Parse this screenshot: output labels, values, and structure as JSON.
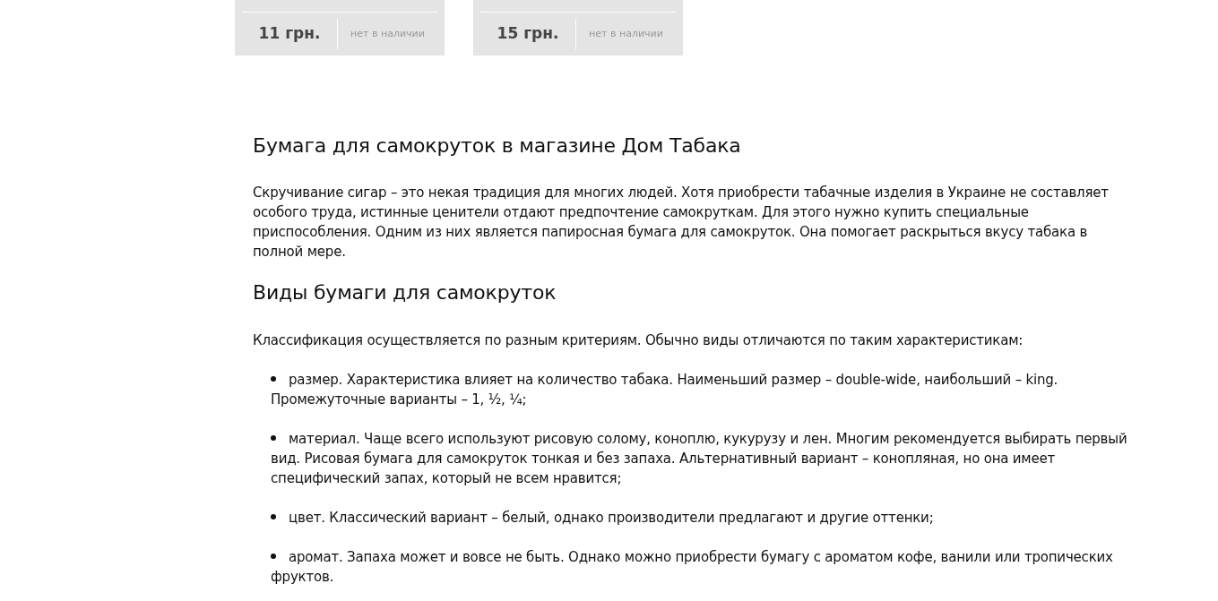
{
  "products": [
    {
      "price": "11 грн.",
      "availability": "нет в наличии"
    },
    {
      "price": "15 грн.",
      "availability": "нет в наличии"
    }
  ],
  "article": [
    {
      "kind": "heading",
      "text": "Бумага для самокруток в магазине Дом Табака"
    },
    {
      "kind": "paragraph",
      "text": "Скручивание сигар – это некая традиция для многих людей. Хотя приобрести табачные изделия в Украине не составляет особого труда, истинные ценители отдают предпочтение самокруткам. Для этого нужно купить специальные приспособления. Одним из них является папиросная бумага для самокруток. Она помогает раскрыться вкусу табака в полной мере."
    },
    {
      "kind": "heading",
      "text": "Виды бумаги для самокруток"
    },
    {
      "kind": "paragraph",
      "text": "Классификация осуществляется по разным критериям. Обычно виды отличаются по таким характеристикам:"
    },
    {
      "kind": "list",
      "items": [
        "размер. Характеристика влияет на количество табака. Наименьший размер – double-wide, наибольший – king. Промежуточные варианты – 1, ½, ¼;",
        "материал. Чаще всего используют рисовую солому, коноплю, кукурузу и лен. Многим рекомендуется выбирать первый вид. Рисовая бумага для самокруток тонкая и без запаха. Альтернативный вариант – конопляная, но она имеет специфический запах, который не всем нравится;",
        "цвет. Классический вариант – белый, однако производители предлагают и другие оттенки;",
        "аромат. Запаха может и вовсе не быть. Однако можно приобрести бумагу с ароматом кофе, ванили или тропических фруктов."
      ]
    }
  ]
}
